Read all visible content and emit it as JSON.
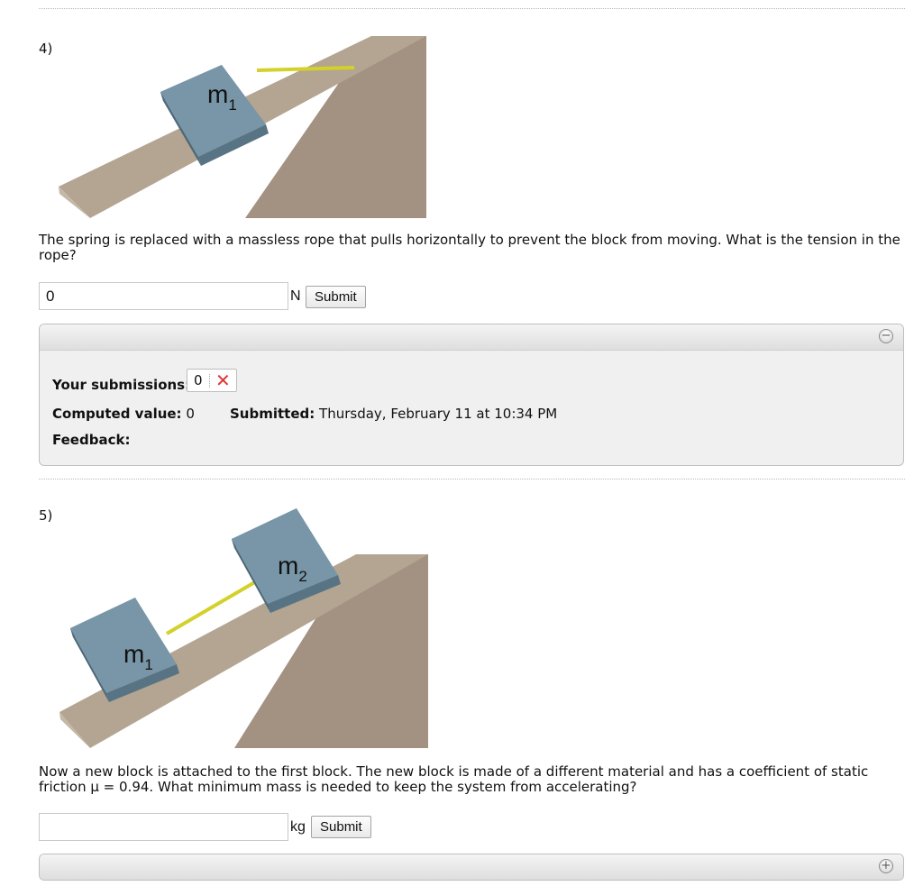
{
  "questions": [
    {
      "number": "4)",
      "figure": {
        "block1_label": "m",
        "block1_subscript": "1"
      },
      "text": "The spring is replaced with a massless rope that pulls horizontally to prevent the block from moving. What is the tension in the rope?",
      "input_value": "0",
      "unit": "N",
      "submit_label": "Submit",
      "panel": {
        "toggle_icon": "minus-circle-icon",
        "toggle_glyph": "−",
        "submissions_label": "Your submissions:",
        "submission_value": "0",
        "submission_status_icon": "red-x-icon",
        "submission_status_glyph": "✕",
        "computed_label": "Computed value:",
        "computed_value": "0",
        "submitted_label": "Submitted:",
        "submitted_value": "Thursday, February 11 at 10:34 PM",
        "feedback_label": "Feedback:"
      }
    },
    {
      "number": "5)",
      "figure": {
        "block1_label": "m",
        "block1_subscript": "1",
        "block2_label": "m",
        "block2_subscript": "2"
      },
      "text": "Now a new block is attached to the first block. The new block is made of a different material and has a coefficient of static friction μ = 0.94. What minimum mass is needed to keep the system from accelerating?",
      "input_value": "",
      "unit": "kg",
      "submit_label": "Submit",
      "panel": {
        "toggle_icon": "plus-circle-icon",
        "toggle_glyph": "+"
      }
    }
  ],
  "colors": {
    "ramp_top": "#b1a38f",
    "ramp_side": "#a39282",
    "block_face": "#7795a6",
    "block_edge": "#4f6a7a",
    "rope": "#d3d12a",
    "error": "#e53131"
  }
}
